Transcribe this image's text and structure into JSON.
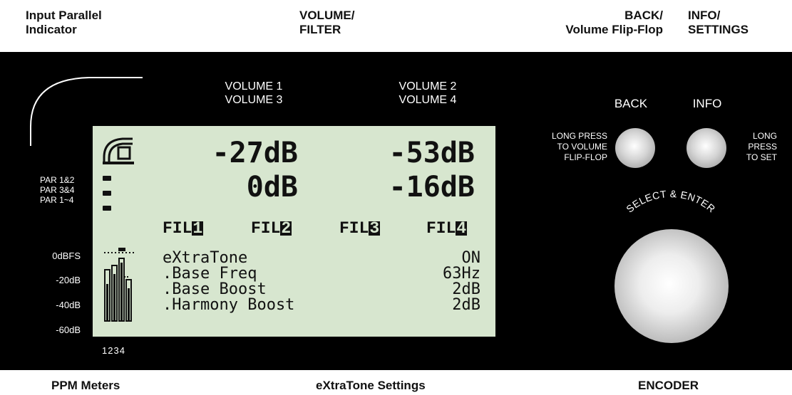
{
  "top_labels": {
    "input_parallel_line1": "Input Parallel",
    "input_parallel_line2": "Indicator",
    "volume_filter_line1": "VOLUME/",
    "volume_filter_line2": "FILTER",
    "back_line1": "BACK/",
    "back_line2": "Volume Flip-Flop",
    "info_line1": "INFO/",
    "info_line2": "SETTINGS"
  },
  "panel": {
    "volume_header_left_1": "VOLUME 1",
    "volume_header_left_2": "VOLUME 3",
    "volume_header_right_1": "VOLUME 2",
    "volume_header_right_2": "VOLUME 4",
    "par_1_2": "PAR 1&2",
    "par_3_4": "PAR 3&4",
    "par_1_4": "PAR 1~4",
    "meter_scale": [
      "0dBFS",
      "-20dB",
      "-40dB",
      "-60dB"
    ],
    "meter_channels": "1234",
    "back_label": "BACK",
    "info_label": "INFO",
    "back_hint": [
      "LONG PRESS",
      "TO VOLUME",
      "FLIP-FLOP"
    ],
    "info_hint": [
      "LONG",
      "PRESS",
      "TO SET"
    ],
    "encoder_label": "SELECT & ENTER"
  },
  "lcd": {
    "vol1": "-27dB",
    "vol2": "-53dB",
    "vol3": "0dB",
    "vol4": "-16dB",
    "fil_prefix": "FIL",
    "fil_numbers": [
      "1",
      "2",
      "3",
      "4"
    ],
    "settings": [
      {
        "name": "eXtraTone",
        "value": "ON"
      },
      {
        "name": ".Base Freq",
        "value": "63Hz"
      },
      {
        "name": ".Base Boost",
        "value": "2dB"
      },
      {
        "name": ".Harmony Boost",
        "value": "2dB"
      }
    ]
  },
  "bottom_labels": {
    "ppm": "PPM Meters",
    "extratone": "eXtraTone Settings",
    "encoder": "ENCODER"
  }
}
